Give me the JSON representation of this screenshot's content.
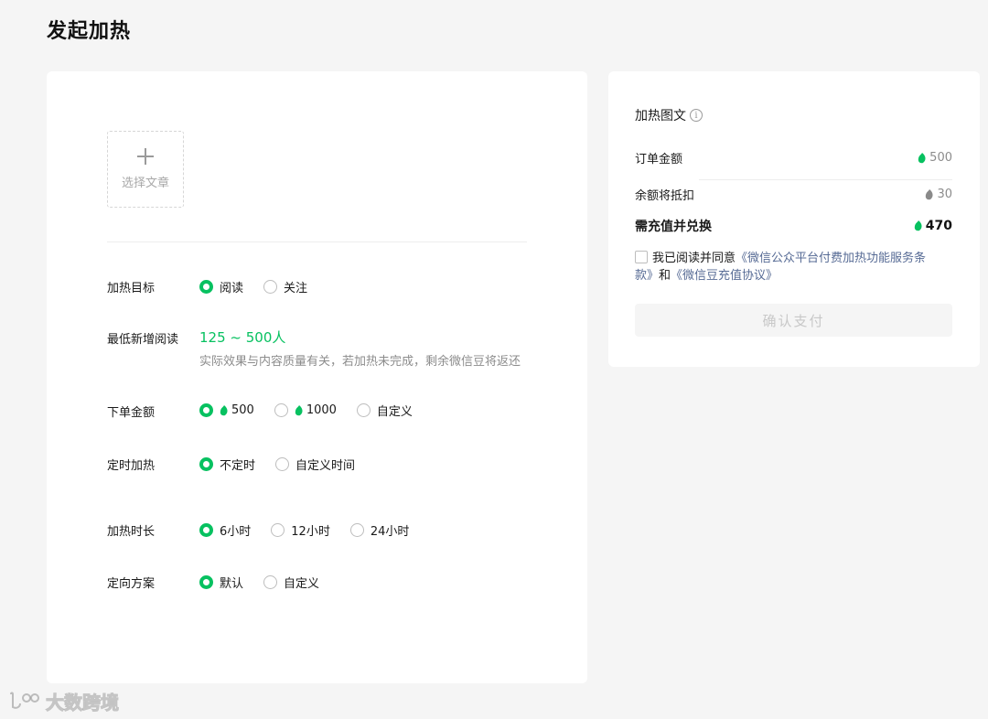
{
  "page": {
    "title": "发起加热"
  },
  "article": {
    "select_label": "选择文章"
  },
  "form": {
    "target": {
      "label": "加热目标",
      "options": [
        "阅读",
        "关注"
      ],
      "selected": 0
    },
    "min_reads": {
      "label": "最低新增阅读",
      "range": "125 ~ 500人",
      "note": "实际效果与内容质量有关，若加热未完成，剩余微信豆将返还"
    },
    "amount": {
      "label": "下单金额",
      "options": [
        "500",
        "1000",
        "自定义"
      ],
      "selected": 0
    },
    "schedule": {
      "label": "定时加热",
      "options": [
        "不定时",
        "自定义时间"
      ],
      "selected": 0
    },
    "duration": {
      "label": "加热时长",
      "options": [
        "6小时",
        "12小时",
        "24小时"
      ],
      "selected": 0
    },
    "targeting": {
      "label": "定向方案",
      "options": [
        "默认",
        "自定义"
      ],
      "selected": 0
    }
  },
  "summary": {
    "title": "加热图文",
    "order_amount": {
      "label": "订单金额",
      "value": "500"
    },
    "balance_deduct": {
      "label": "余额将抵扣",
      "value": "30"
    },
    "need_recharge": {
      "label": "需充值并兑换",
      "value": "470"
    },
    "agreement": {
      "prefix": "我已阅读并同意",
      "link1": "《微信公众平台付费加热功能服务条款》",
      "and": "和",
      "link2": "《微信豆充值协议》"
    },
    "pay_button": "确认支付"
  },
  "watermark": {
    "text": "大数跨境"
  },
  "colors": {
    "accent": "#07c160",
    "link": "#576b95",
    "bean_gray": "#8a8a8a"
  }
}
